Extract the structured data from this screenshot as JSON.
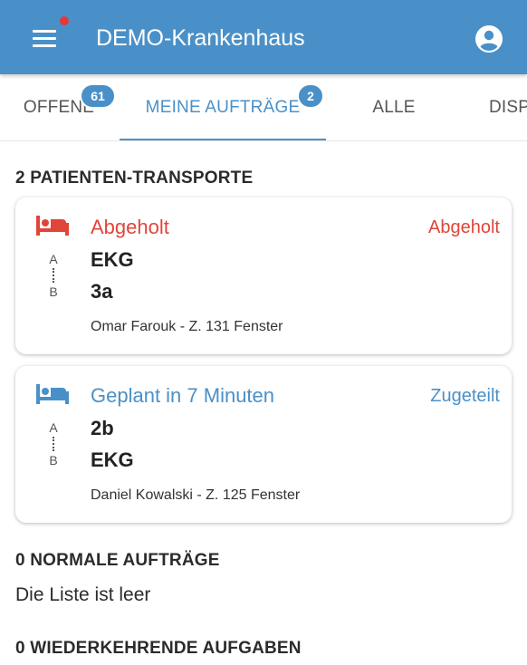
{
  "app": {
    "title": "DEMO-Krankenhaus"
  },
  "tabs": [
    {
      "label": "OFFENE",
      "badge": "61"
    },
    {
      "label": "MEINE AUFTRÄGE",
      "badge": "2",
      "active": true
    },
    {
      "label": "ALLE"
    },
    {
      "label": "DISP"
    }
  ],
  "sections": {
    "transports": {
      "heading": "2 PATIENTEN-TRANSPORTE"
    },
    "normal": {
      "heading": "0 NORMALE AUFTRÄGE",
      "empty_text": "Die Liste ist leer"
    },
    "recurring": {
      "heading": "0 WIEDERKEHRENDE AUFGABEN"
    }
  },
  "route_labels": {
    "from": "A",
    "to": "B"
  },
  "transports": [
    {
      "status": "Abgeholt",
      "state": "Abgeholt",
      "from": "EKG",
      "to": "3a",
      "patient": "Omar Farouk - Z. 131 Fenster",
      "color": "#e0453a",
      "icon": "bed-icon"
    },
    {
      "status": "Geplant in 7 Minuten",
      "state": "Zugeteilt",
      "from": "2b",
      "to": "EKG",
      "patient": "Daniel Kowalski - Z. 125 Fenster",
      "color": "#4a90c8",
      "icon": "bed-icon"
    }
  ],
  "colors": {
    "primary": "#4a90c8",
    "danger": "#e0453a",
    "notification": "#e53935"
  }
}
